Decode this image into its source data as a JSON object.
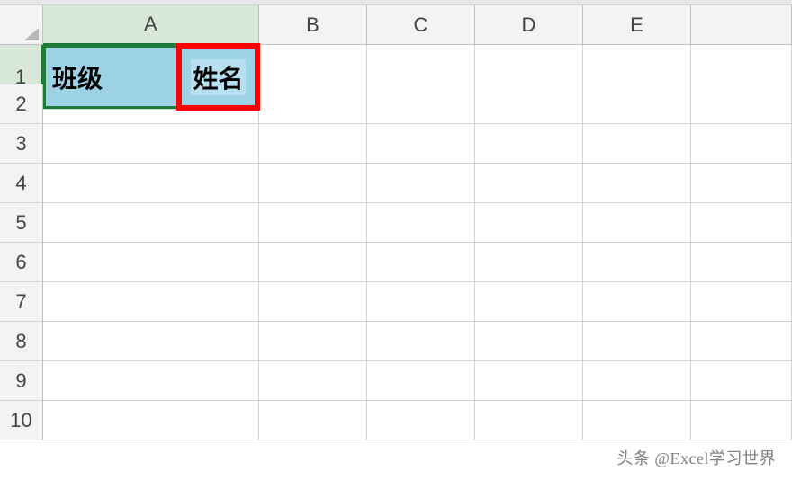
{
  "columns": [
    "A",
    "B",
    "C",
    "D",
    "E",
    ""
  ],
  "rows": [
    "1",
    "2",
    "3",
    "4",
    "5",
    "6",
    "7",
    "8",
    "9",
    "10"
  ],
  "selected_row": 0,
  "selected_col": 0,
  "cell_a1": {
    "left_text": "班级",
    "right_text": "姓名"
  },
  "watermark": "头条 @Excel学习世界"
}
